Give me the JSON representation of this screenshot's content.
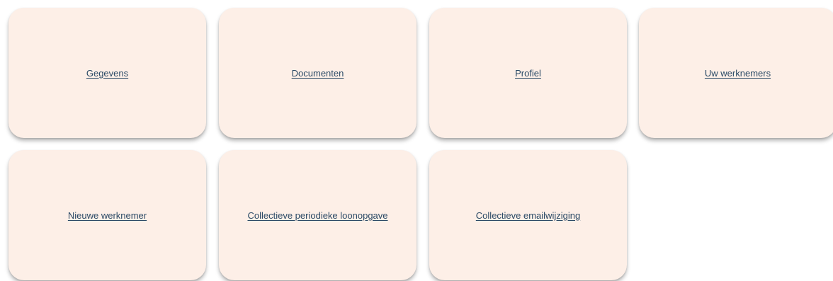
{
  "tiles": [
    {
      "label": "Gegevens"
    },
    {
      "label": "Documenten"
    },
    {
      "label": "Profiel"
    },
    {
      "label": "Uw werknemers"
    },
    {
      "label": "Nieuwe werknemer"
    },
    {
      "label": "Collectieve periodieke loonopgave"
    },
    {
      "label": "Collectieve emailwijziging"
    }
  ],
  "colors": {
    "tile_background": "#fdefe7",
    "link_text": "#2b4a66"
  }
}
